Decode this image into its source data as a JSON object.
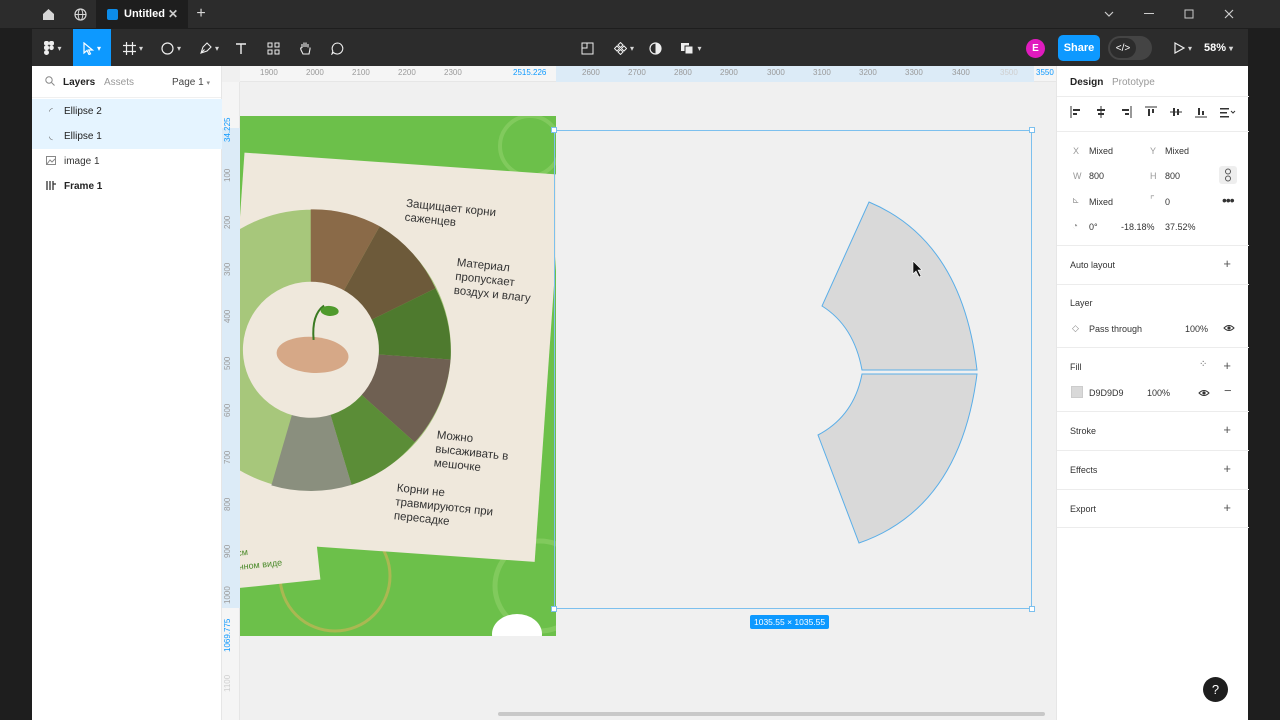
{
  "tabbar": {
    "tab_title": "Untitled",
    "new_tab": "+",
    "close_tab": "✕"
  },
  "toolbar": {
    "share_label": "Share",
    "avatar_initial": "E",
    "zoom": "58%"
  },
  "left_panel": {
    "tab_layers": "Layers",
    "tab_assets": "Assets",
    "page": "Page 1",
    "layers": [
      {
        "name": "Ellipse 2",
        "icon": "ellipse-icon",
        "selected": true
      },
      {
        "name": "Ellipse 1",
        "icon": "ellipse-icon",
        "selected": true
      },
      {
        "name": "image 1",
        "icon": "image-icon",
        "selected": false
      },
      {
        "name": "Frame 1",
        "icon": "frame-icon",
        "selected": false
      }
    ]
  },
  "canvas": {
    "ruler_top": [
      "1900",
      "2000",
      "2100",
      "2200",
      "2300",
      "2515.226",
      "2600",
      "2700",
      "2800",
      "2900",
      "3000",
      "3100",
      "3200",
      "3300",
      "3400",
      "3500",
      "3550"
    ],
    "ruler_left": [
      "34.225",
      "100",
      "200",
      "300",
      "400",
      "500",
      "600",
      "700",
      "800",
      "900",
      "1000",
      "1069.775",
      "1100"
    ],
    "selection_size": "1035.55 × 1035.55",
    "poster": {
      "points": [
        "Защищает корни саженцев",
        "Материал пропускает воздух и влагу",
        "Можно высаживать в мешочке",
        "Корни не травмируются при пересадке"
      ],
      "caption_line1": "см",
      "caption_line2": "нном виде",
      "green": "#6cc04a",
      "paper": "#efe8dc"
    }
  },
  "right_panel": {
    "tab_design": "Design",
    "tab_prototype": "Prototype",
    "x_label": "X",
    "x_value": "Mixed",
    "y_label": "Y",
    "y_value": "Mixed",
    "w_label": "W",
    "w_value": "800",
    "h_label": "H",
    "h_value": "800",
    "rotation_value": "Mixed",
    "radius_value": "0",
    "arc_start": "0°",
    "arc_sweep": "-18.18%",
    "arc_ratio": "37.52%",
    "auto_layout": "Auto layout",
    "layer_title": "Layer",
    "blend_mode": "Pass through",
    "layer_opacity": "100%",
    "fill_title": "Fill",
    "fill_hex": "D9D9D9",
    "fill_opacity": "100%",
    "fill_color": "#D9D9D9",
    "stroke": "Stroke",
    "effects": "Effects",
    "export": "Export"
  },
  "help": "?"
}
